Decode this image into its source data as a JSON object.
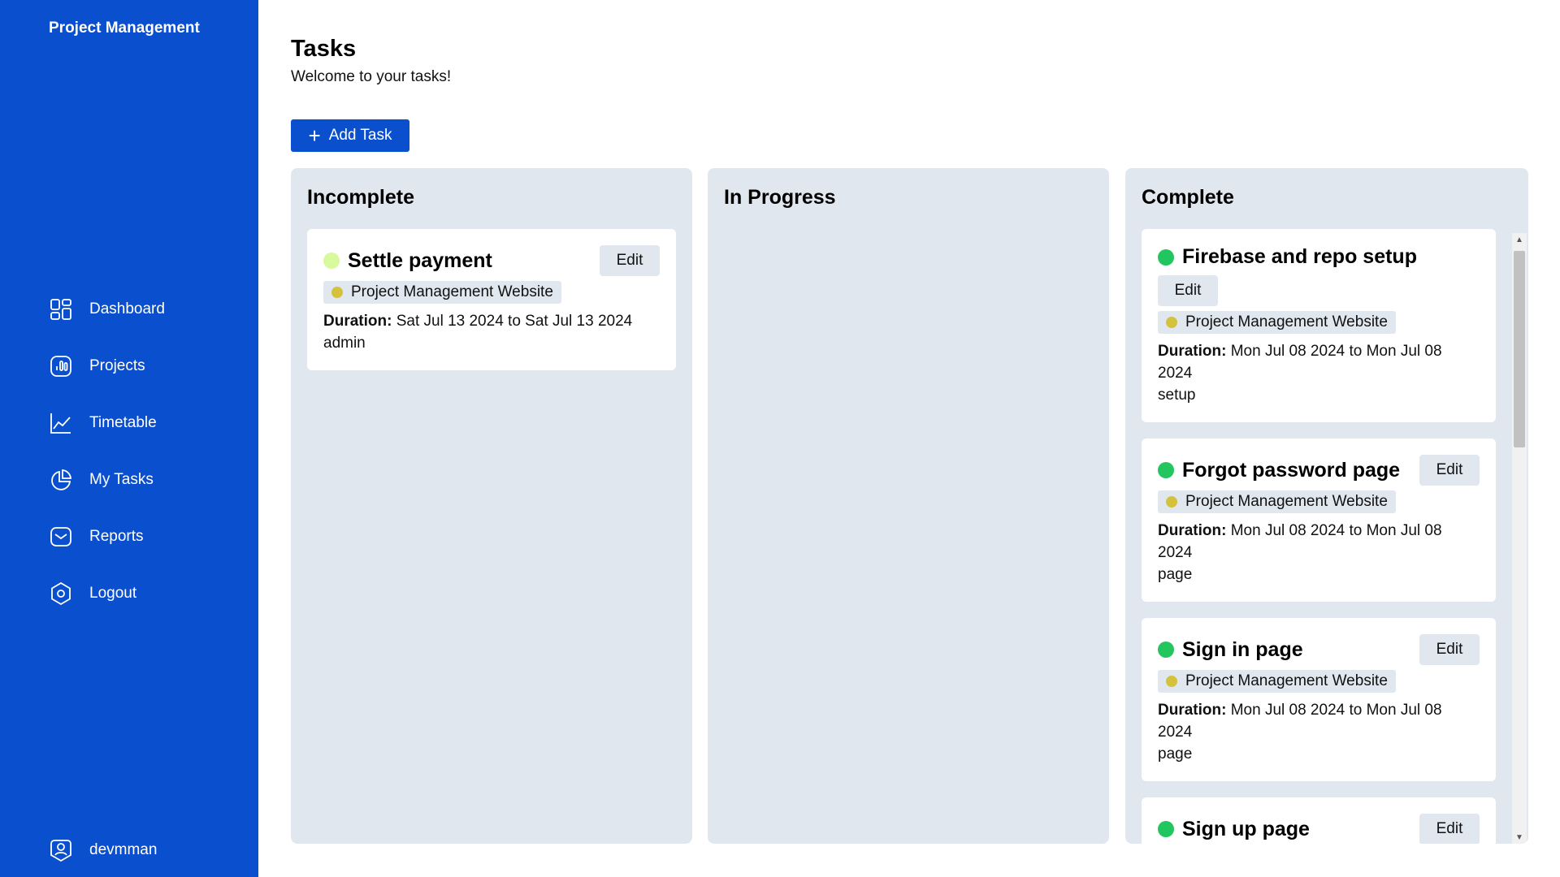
{
  "sidebar": {
    "brand": "Project Management",
    "items": [
      {
        "label": "Dashboard",
        "icon": "dashboard-icon"
      },
      {
        "label": "Projects",
        "icon": "bar-chart-icon"
      },
      {
        "label": "Timetable",
        "icon": "line-chart-icon"
      },
      {
        "label": "My Tasks",
        "icon": "pie-chart-icon"
      },
      {
        "label": "Reports",
        "icon": "mail-icon"
      },
      {
        "label": "Logout",
        "icon": "hexagon-icon"
      }
    ],
    "user": {
      "name": "devmman",
      "icon": "user-badge-icon"
    }
  },
  "header": {
    "title": "Tasks",
    "subtitle": "Welcome to your tasks!",
    "add_label": "Add Task"
  },
  "columns": [
    {
      "title": "Incomplete",
      "cards": [
        {
          "title": "Settle payment",
          "edit": "Edit",
          "project": "Project Management Website",
          "duration_label": "Duration:",
          "duration": " Sat Jul 13 2024 to Sat Jul 13 2024",
          "note": "admin"
        }
      ]
    },
    {
      "title": "In Progress",
      "cards": []
    },
    {
      "title": "Complete",
      "cards": [
        {
          "title": "Firebase and repo setup",
          "edit": "Edit",
          "project": "Project Management Website",
          "duration_label": "Duration:",
          "duration": " Mon Jul 08 2024 to Mon Jul 08 2024",
          "note": "setup"
        },
        {
          "title": "Forgot password page",
          "edit": "Edit",
          "project": "Project Management Website",
          "duration_label": "Duration:",
          "duration": " Mon Jul 08 2024 to Mon Jul 08 2024",
          "note": "page"
        },
        {
          "title": "Sign in page",
          "edit": "Edit",
          "project": "Project Management Website",
          "duration_label": "Duration:",
          "duration": " Mon Jul 08 2024 to Mon Jul 08 2024",
          "note": "page"
        },
        {
          "title": "Sign up page",
          "edit": "Edit"
        }
      ]
    }
  ],
  "colors": {
    "sidebar": "#0a4fce",
    "column_bg": "#e1e7ef",
    "incomplete_dot": "#d9f99d",
    "complete_dot": "#22c55e",
    "project_dot": "#d4c13c"
  }
}
